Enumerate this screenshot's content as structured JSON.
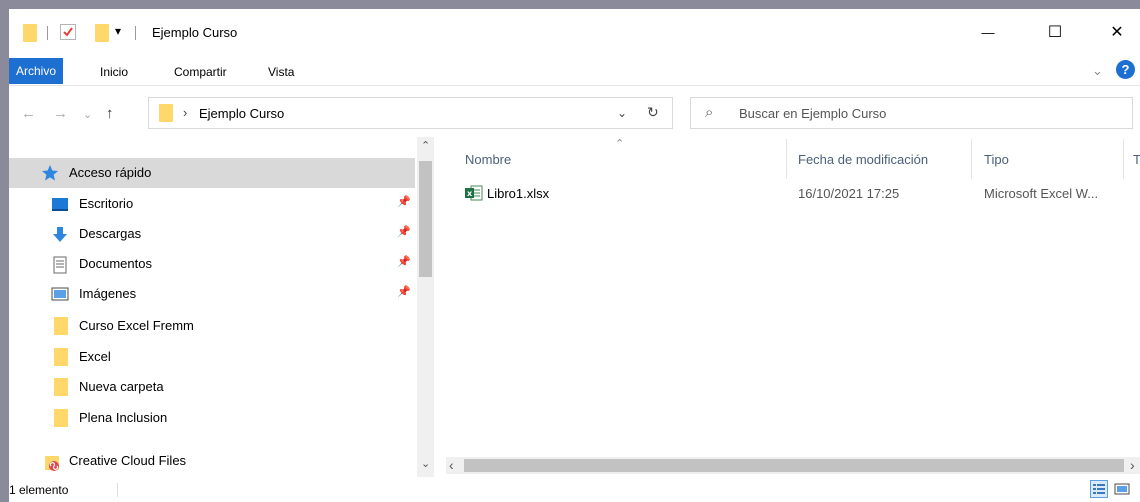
{
  "window": {
    "title": "Ejemplo Curso"
  },
  "window_controls": {
    "minimize": "—",
    "maximize": "☐",
    "close": "✕"
  },
  "qat": {
    "dropdown": "▾"
  },
  "ribbon": {
    "tabs": [
      {
        "label": "Archivo"
      },
      {
        "label": "Inicio"
      },
      {
        "label": "Compartir"
      },
      {
        "label": "Vista"
      }
    ],
    "expand": "⌄",
    "help": "?"
  },
  "address": {
    "back": "←",
    "forward": "→",
    "recent": "⌄",
    "up": "↑",
    "chevron": "›",
    "path": "Ejemplo Curso",
    "dropdown": "⌄",
    "refresh": "↻"
  },
  "search": {
    "placeholder": "Buscar en Ejemplo Curso",
    "icon": "⌕"
  },
  "nav": {
    "quick_access": "Acceso rápido",
    "items": [
      {
        "label": "Escritorio",
        "pin": "📌"
      },
      {
        "label": "Descargas",
        "pin": "📌"
      },
      {
        "label": "Documentos",
        "pin": "📌"
      },
      {
        "label": "Imágenes",
        "pin": "📌"
      },
      {
        "label": "Curso Excel Fremm"
      },
      {
        "label": "Excel"
      },
      {
        "label": "Nueva carpeta"
      },
      {
        "label": "Plena Inclusion"
      }
    ],
    "creative_cloud": "Creative Cloud Files",
    "scroll_up": "⌃",
    "scroll_down": "⌄"
  },
  "list": {
    "sort_indicator": "⌃",
    "columns": [
      "Nombre",
      "Fecha de modificación",
      "Tipo",
      "T"
    ],
    "files": [
      {
        "name": "Libro1.xlsx",
        "modified": "16/10/2021 17:25",
        "type": "Microsoft Excel W..."
      }
    ],
    "scroll_left": "‹",
    "scroll_right": "›"
  },
  "status": {
    "count": "1 elemento"
  },
  "colors": {
    "accent": "#1e6fd2",
    "folder": "#ffd76a",
    "selected": "#d9d9d9",
    "header_text": "#4c607a"
  }
}
